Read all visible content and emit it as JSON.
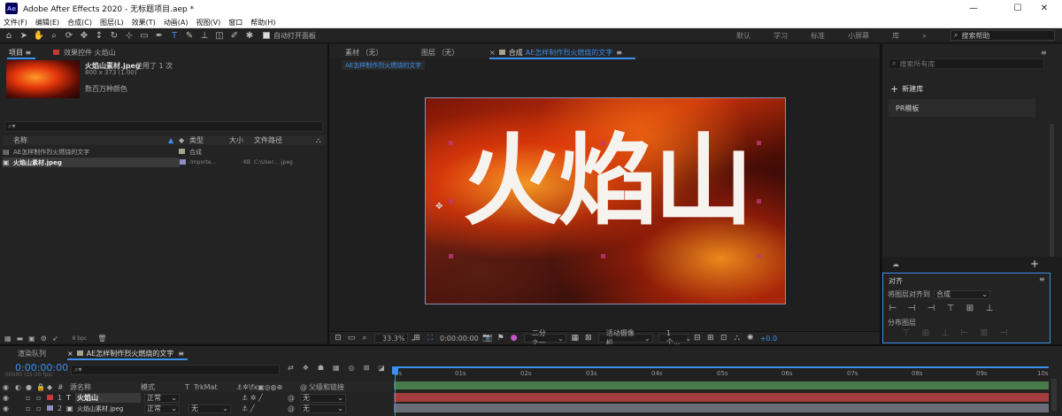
{
  "window": {
    "title": "Adobe After Effects 2020 - 无标题项目.aep *",
    "logo": "Ae",
    "minimize": "—",
    "maximize": "☐",
    "close": "✕"
  },
  "menu": [
    "文件(F)",
    "编辑(E)",
    "合成(C)",
    "图层(L)",
    "效果(T)",
    "动画(A)",
    "视图(V)",
    "窗口",
    "帮助(H)"
  ],
  "toolbar": {
    "auto_open_label": "自动打开面板",
    "workspaces": [
      "默认",
      "学习",
      "标准",
      "小屏幕",
      "库"
    ],
    "more": "»",
    "search_placeholder": "搜索帮助"
  },
  "project_panel": {
    "tab_project": "项目 ≡",
    "tab_effects": "效果控件 火焰山",
    "asset_name": "火焰山素材.jpeg",
    "asset_used": "，使用了 1 次",
    "asset_dims": "800 x 373 (1.00)",
    "asset_colors": "数百万种颜色",
    "search_placeholder": "⌕▾",
    "columns": [
      "名称",
      "类型",
      "大小",
      "文件路径"
    ],
    "rows": [
      {
        "name": "AE怎样制作烈火燃烧的文字",
        "type": "合成",
        "size": "",
        "path": ""
      },
      {
        "name": "火焰山素材.jpeg",
        "type": "Importe...",
        "size": "KB",
        "path": "C:\\User... .jpeg"
      }
    ],
    "bpc": "8 bpc"
  },
  "viewer": {
    "tab_footage": "素材 （无）",
    "tab_layer": "图层 （无）",
    "tab_comp_prefix": "合成",
    "tab_comp_name": "AE怎样制作烈火燃烧的文字",
    "comp_subtab": "AE怎样制作烈火燃烧的文字",
    "comp_text": "火焰山",
    "zoom": "33.3%",
    "timecode": "0:00:00:00",
    "resolution": "二分之一",
    "camera": "活动摄像机",
    "views": "1个...",
    "exposure": "+0.0"
  },
  "right_panel": {
    "search_placeholder": "搜索所有库",
    "new_library": "新建库",
    "library_item": "PR模板",
    "align_title": "对齐",
    "align_to_label": "将图层对齐到",
    "align_to_value": "合成",
    "distribute_label": "分布图层"
  },
  "timeline": {
    "tab_render": "渲染队列",
    "tab_comp": "AE怎样制作烈火燃烧的文字",
    "time": "0:00:00:00",
    "fps": "00000 (25.00 fps)",
    "search_placeholder": "⌕▾",
    "col_source": "源名称",
    "col_mode": "模式",
    "col_t": "T",
    "col_trkmat": "TrkMat",
    "col_parent": "父级和链接",
    "ruler": [
      "0s",
      "01s",
      "02s",
      "03s",
      "04s",
      "05s",
      "06s",
      "07s",
      "08s",
      "09s",
      "10s"
    ],
    "layers": [
      {
        "num": "1",
        "type": "T",
        "name": "火焰山",
        "mode": "正常",
        "trkmat": "",
        "parent": "无",
        "color": "#c73a3a"
      },
      {
        "num": "2",
        "type": "▣",
        "name": "火焰山素材.jpeg",
        "mode": "正常",
        "trkmat": "无",
        "parent": "无",
        "color": "#8d8fc0"
      }
    ]
  },
  "colors": {
    "accent": "#3d8ff0",
    "layer1_track": "#a33c3c",
    "layer2_track": "#6a6d78",
    "work_area": "#4a9a4a"
  }
}
